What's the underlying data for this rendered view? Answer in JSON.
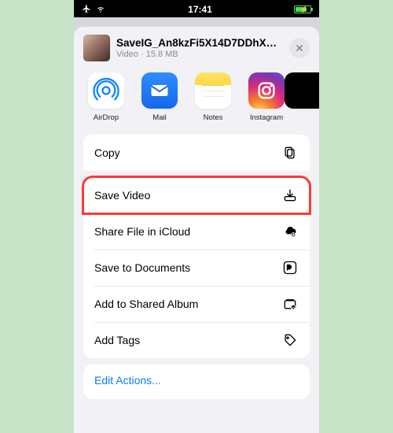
{
  "status": {
    "time": "17:41"
  },
  "file": {
    "title": "SaveIG_An8kzFi5X14D7DDhXM...",
    "kind": "Video",
    "size": "15.8 MB"
  },
  "share_targets": [
    {
      "id": "airdrop",
      "label": "AirDrop"
    },
    {
      "id": "mail",
      "label": "Mail"
    },
    {
      "id": "notes",
      "label": "Notes"
    },
    {
      "id": "instagram",
      "label": "Instagram"
    }
  ],
  "actions": {
    "copy": "Copy",
    "save_video": "Save Video",
    "icloud": "Share File in iCloud",
    "save_docs": "Save to Documents",
    "shared_album": "Add to Shared Album",
    "add_tags": "Add Tags"
  },
  "footer": {
    "edit_actions": "Edit Actions..."
  },
  "colors": {
    "tint": "#0a7aff",
    "highlight": "#ff3b30"
  }
}
